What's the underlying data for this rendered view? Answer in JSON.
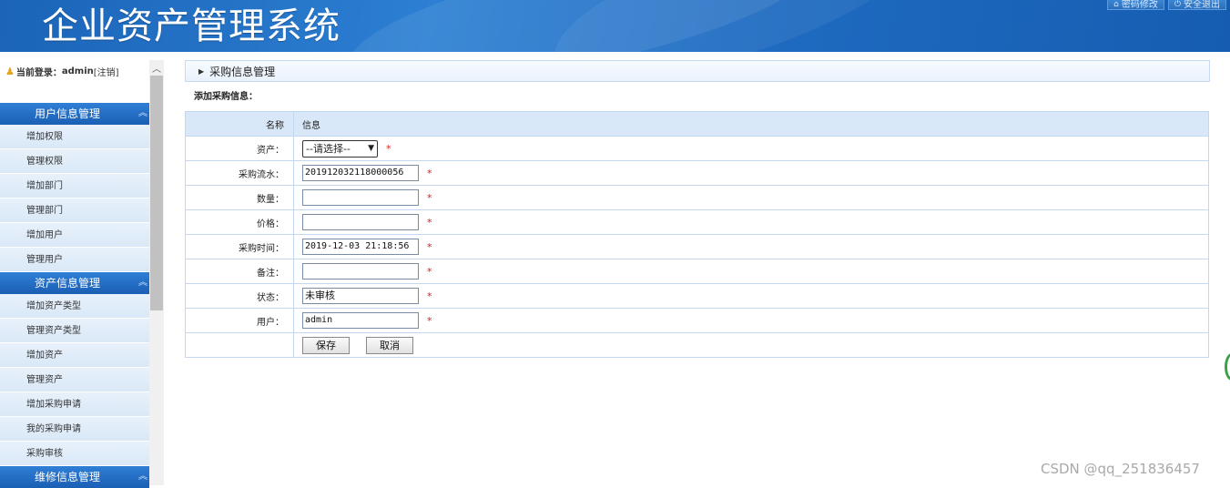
{
  "header": {
    "title": "企业资产管理系统",
    "links": [
      {
        "icon": "home-icon",
        "label": "密码修改"
      },
      {
        "icon": "power-icon",
        "label": "安全退出"
      }
    ]
  },
  "sidebar": {
    "login_prefix": "当前登录：",
    "login_user": "admin",
    "logout_label": "[注销]",
    "groups": [
      {
        "title": "用户信息管理",
        "items": [
          "增加权限",
          "管理权限",
          "增加部门",
          "管理部门",
          "增加用户",
          "管理用户"
        ]
      },
      {
        "title": "资产信息管理",
        "items": [
          "增加资产类型",
          "管理资产类型",
          "增加资产",
          "管理资产",
          "增加采购申请",
          "我的采购申请",
          "采购审核"
        ]
      },
      {
        "title": "维修信息管理",
        "items": []
      }
    ]
  },
  "main": {
    "breadcrumb": "采购信息管理",
    "subtitle": "添加采购信息：",
    "table_header": {
      "name": "名称",
      "info": "信息"
    },
    "fields": {
      "asset": {
        "label": "资产：",
        "value": "--请选择--"
      },
      "serial": {
        "label": "采购流水：",
        "value": "201912032118000056"
      },
      "quantity": {
        "label": "数量：",
        "value": ""
      },
      "price": {
        "label": "价格：",
        "value": ""
      },
      "time": {
        "label": "采购时间：",
        "value": "2019-12-03 21:18:56"
      },
      "remark": {
        "label": "备注：",
        "value": ""
      },
      "status": {
        "label": "状态：",
        "value": "未审核"
      },
      "user": {
        "label": "用户：",
        "value": "admin"
      }
    },
    "required_mark": "*",
    "save_label": "保存",
    "cancel_label": "取消"
  },
  "watermark": "CSDN @qq_251836457"
}
